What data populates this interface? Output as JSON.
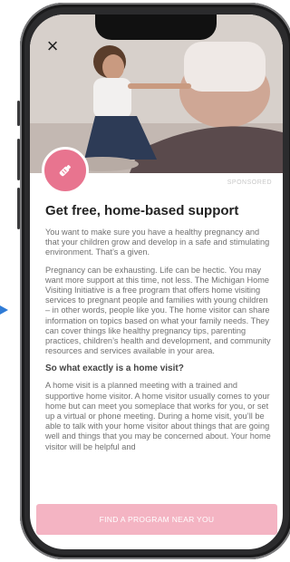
{
  "colors": {
    "accent_pink": "#e8748f",
    "cta_background": "#f4b4c3",
    "marker_blue": "#2f7bd6"
  },
  "icons": {
    "close": "close-icon",
    "badge": "baby-bottle-icon",
    "arrow": "arrow-right-icon"
  },
  "header": {
    "close_symbol": "×",
    "sponsored_label": "SPONSORED"
  },
  "article": {
    "title": "Get free, home-based support",
    "paragraph_1": "You want to make sure you have a healthy pregnancy and that your children grow and develop in a safe and stimulating environment. That’s a given.",
    "paragraph_2": "Pregnancy can be exhausting. Life can be hectic. You may want more support at this time, not less. The Michigan Home Visiting Initiative is a free program that offers home visiting services to pregnant people and families with young children – in other words, people like you. The home visitor can share information on topics based on what your family needs. They can cover things like healthy pregnancy tips, parenting practices, children’s health and development, and community resources and services available in your area.",
    "subheading": "So what exactly is a home visit?",
    "paragraph_3": "A home visit is a planned meeting with a trained and supportive home visitor. A home visitor usually comes to your home but can meet you someplace that works for you, or set up a virtual or phone meeting. During a home visit, you’ll be able to talk with your home visitor about things that are going well and things that you may be concerned about. Your home visitor will be helpful and"
  },
  "cta": {
    "label": "FIND A PROGRAM NEAR YOU"
  }
}
